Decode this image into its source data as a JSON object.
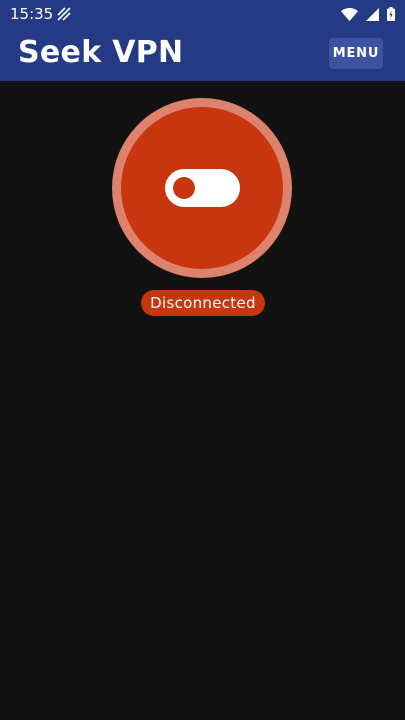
{
  "status_bar": {
    "time": "15:35",
    "icons": [
      "striped-notification-icon",
      "wifi-icon",
      "cellular-signal-icon",
      "battery-icon"
    ]
  },
  "app_bar": {
    "title": "Seek VPN",
    "menu_label": "MENU",
    "background_color": "#243a85"
  },
  "connection": {
    "status_text": "Disconnected",
    "status_color": "#c7360e",
    "toggle_state": "off",
    "icons": [
      "toggle-off-icon"
    ]
  }
}
